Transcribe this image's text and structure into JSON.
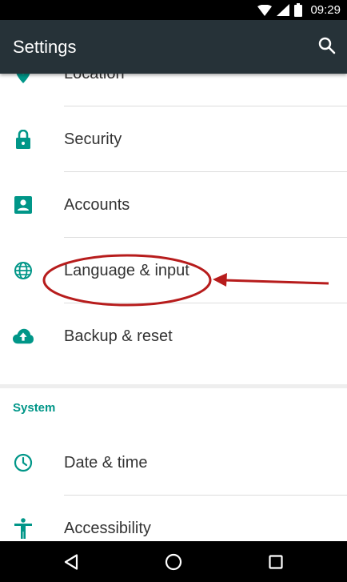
{
  "status_bar": {
    "time": "09:29",
    "icons": [
      "wifi-icon",
      "signal-icon",
      "battery-icon"
    ]
  },
  "app_bar": {
    "title": "Settings",
    "search_icon": "search-icon"
  },
  "personal_items": [
    {
      "label": "Location",
      "icon": "location-pin-icon"
    },
    {
      "label": "Security",
      "icon": "lock-icon"
    },
    {
      "label": "Accounts",
      "icon": "account-box-icon"
    },
    {
      "label": "Language & input",
      "icon": "globe-icon"
    },
    {
      "label": "Backup & reset",
      "icon": "cloud-upload-icon"
    }
  ],
  "system_section": {
    "header": "System",
    "items": [
      {
        "label": "Date & time",
        "icon": "clock-icon"
      },
      {
        "label": "Accessibility",
        "icon": "accessibility-icon"
      }
    ]
  },
  "nav_bar": {
    "buttons": [
      "back-icon",
      "home-icon",
      "recents-icon"
    ]
  },
  "colors": {
    "app_bar": "#263238",
    "accent": "#009688",
    "annotation": "#b71c1c"
  }
}
